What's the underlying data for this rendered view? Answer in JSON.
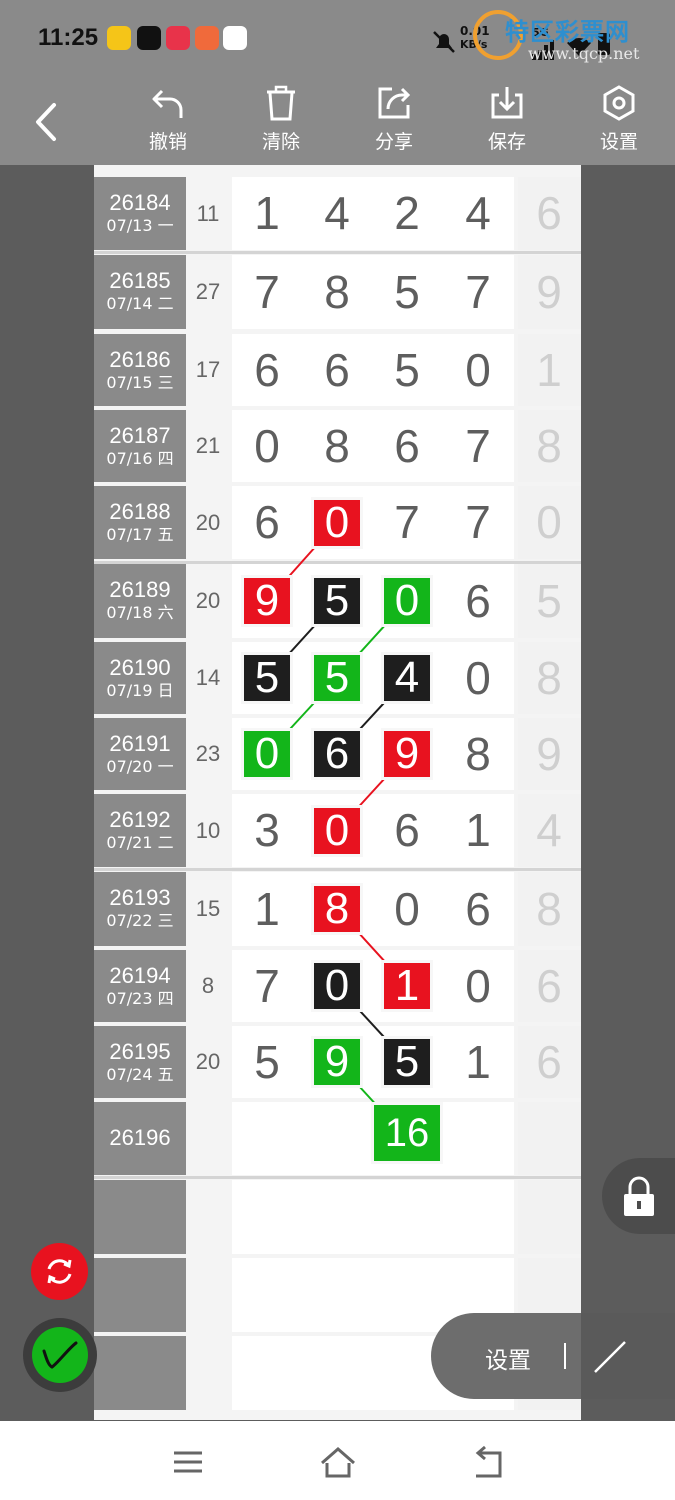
{
  "status": {
    "time": "11:25",
    "net_speed_top": "0.01",
    "net_speed_unit": "KB/s",
    "signal": "5G"
  },
  "watermark": {
    "title": "特区彩票网",
    "url": "www.tqcp.net"
  },
  "toolbar": {
    "undo": "撤销",
    "clear": "清除",
    "share": "分享",
    "save": "保存",
    "settings": "设置"
  },
  "rows": [
    {
      "id": "26184",
      "date": "07/13 一",
      "sum": "11",
      "digits": [
        "1",
        "4",
        "2",
        "4"
      ],
      "last": "6"
    },
    {
      "id": "26185",
      "date": "07/14 二",
      "sum": "27",
      "digits": [
        "7",
        "8",
        "5",
        "7"
      ],
      "last": "9"
    },
    {
      "id": "26186",
      "date": "07/15 三",
      "sum": "17",
      "digits": [
        "6",
        "6",
        "5",
        "0"
      ],
      "last": "1"
    },
    {
      "id": "26187",
      "date": "07/16 四",
      "sum": "21",
      "digits": [
        "0",
        "8",
        "6",
        "7"
      ],
      "last": "8"
    },
    {
      "id": "26188",
      "date": "07/17 五",
      "sum": "20",
      "digits": [
        "6",
        "0",
        "7",
        "7"
      ],
      "last": "0"
    },
    {
      "id": "26189",
      "date": "07/18 六",
      "sum": "20",
      "digits": [
        "9",
        "5",
        "0",
        "6"
      ],
      "last": "5"
    },
    {
      "id": "26190",
      "date": "07/19 日",
      "sum": "14",
      "digits": [
        "5",
        "5",
        "4",
        "0"
      ],
      "last": "8"
    },
    {
      "id": "26191",
      "date": "07/20 一",
      "sum": "23",
      "digits": [
        "0",
        "6",
        "9",
        "8"
      ],
      "last": "9"
    },
    {
      "id": "26192",
      "date": "07/21 二",
      "sum": "10",
      "digits": [
        "3",
        "0",
        "6",
        "1"
      ],
      "last": "4"
    },
    {
      "id": "26193",
      "date": "07/22 三",
      "sum": "15",
      "digits": [
        "1",
        "8",
        "0",
        "6"
      ],
      "last": "8"
    },
    {
      "id": "26194",
      "date": "07/23 四",
      "sum": "8",
      "digits": [
        "7",
        "0",
        "1",
        "0"
      ],
      "last": "6"
    },
    {
      "id": "26195",
      "date": "07/24 五",
      "sum": "20",
      "digits": [
        "5",
        "9",
        "5",
        "1"
      ],
      "last": "6"
    },
    {
      "id": "26196",
      "date": "",
      "sum": "",
      "digits": [
        "",
        "",
        "",
        ""
      ],
      "last": ""
    }
  ],
  "highlights": [
    {
      "row": 4,
      "col": 1,
      "color": "red"
    },
    {
      "row": 5,
      "col": 0,
      "color": "red"
    },
    {
      "row": 5,
      "col": 1,
      "color": "black"
    },
    {
      "row": 5,
      "col": 2,
      "color": "green"
    },
    {
      "row": 6,
      "col": 0,
      "color": "black"
    },
    {
      "row": 6,
      "col": 1,
      "color": "green"
    },
    {
      "row": 6,
      "col": 2,
      "color": "black"
    },
    {
      "row": 7,
      "col": 0,
      "color": "green"
    },
    {
      "row": 7,
      "col": 1,
      "color": "black"
    },
    {
      "row": 7,
      "col": 2,
      "color": "red"
    },
    {
      "row": 8,
      "col": 1,
      "color": "red"
    },
    {
      "row": 9,
      "col": 1,
      "color": "red"
    },
    {
      "row": 10,
      "col": 1,
      "color": "black"
    },
    {
      "row": 10,
      "col": 2,
      "color": "red"
    },
    {
      "row": 11,
      "col": 1,
      "color": "green"
    },
    {
      "row": 11,
      "col": 2,
      "color": "black"
    }
  ],
  "prediction": {
    "row": 12,
    "col": 2,
    "value": "16",
    "color": "green"
  },
  "connectors": [
    {
      "from": [
        4,
        1
      ],
      "to": [
        5,
        0
      ],
      "color": "#e8121f"
    },
    {
      "from": [
        5,
        1
      ],
      "to": [
        6,
        0
      ],
      "color": "#1e1e1e"
    },
    {
      "from": [
        5,
        2
      ],
      "to": [
        6,
        1
      ],
      "color": "#13b51a"
    },
    {
      "from": [
        6,
        1
      ],
      "to": [
        7,
        0
      ],
      "color": "#13b51a"
    },
    {
      "from": [
        6,
        2
      ],
      "to": [
        7,
        1
      ],
      "color": "#1e1e1e"
    },
    {
      "from": [
        7,
        2
      ],
      "to": [
        8,
        1
      ],
      "color": "#e8121f"
    },
    {
      "from": [
        9,
        1
      ],
      "to": [
        10,
        2
      ],
      "color": "#e8121f"
    },
    {
      "from": [
        10,
        1
      ],
      "to": [
        11,
        2
      ],
      "color": "#1e1e1e"
    },
    {
      "from": [
        11,
        1
      ],
      "to": [
        12,
        2
      ],
      "color": "#13b51a"
    }
  ],
  "colors": {
    "red": "#e8121f",
    "black": "#1e1e1e",
    "green": "#13b51a"
  },
  "floating": {
    "settings_label": "设置"
  }
}
